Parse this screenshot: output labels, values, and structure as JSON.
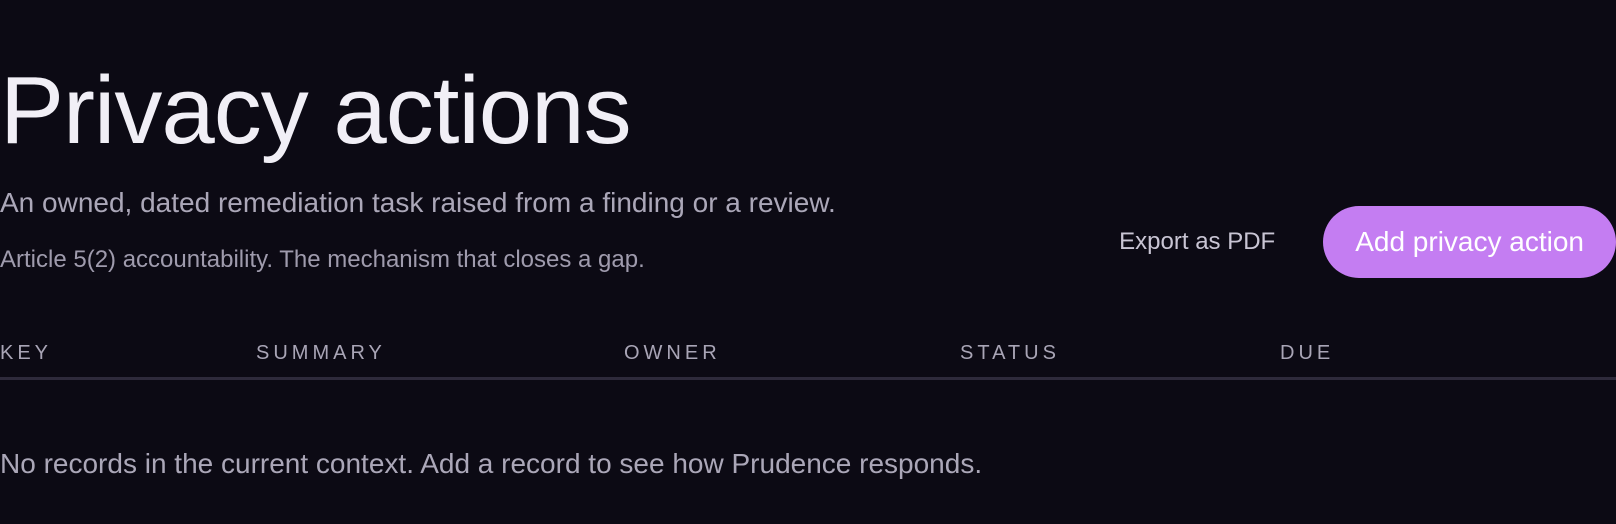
{
  "header": {
    "title": "Privacy actions",
    "subtitle": "An owned, dated remediation task raised from a finding or a review.",
    "note": "Article 5(2) accountability. The mechanism that closes a gap."
  },
  "actions": {
    "export_label": "Export as PDF",
    "add_label": "Add privacy action"
  },
  "table": {
    "columns": [
      "KEY",
      "SUMMARY",
      "OWNER",
      "STATUS",
      "DUE"
    ],
    "rows": [],
    "empty_message": "No records in the current context. Add a record to see how Prudence responds."
  },
  "colors": {
    "background": "#0c0a14",
    "accent": "#c47df2",
    "divider": "#2e2a3b"
  }
}
